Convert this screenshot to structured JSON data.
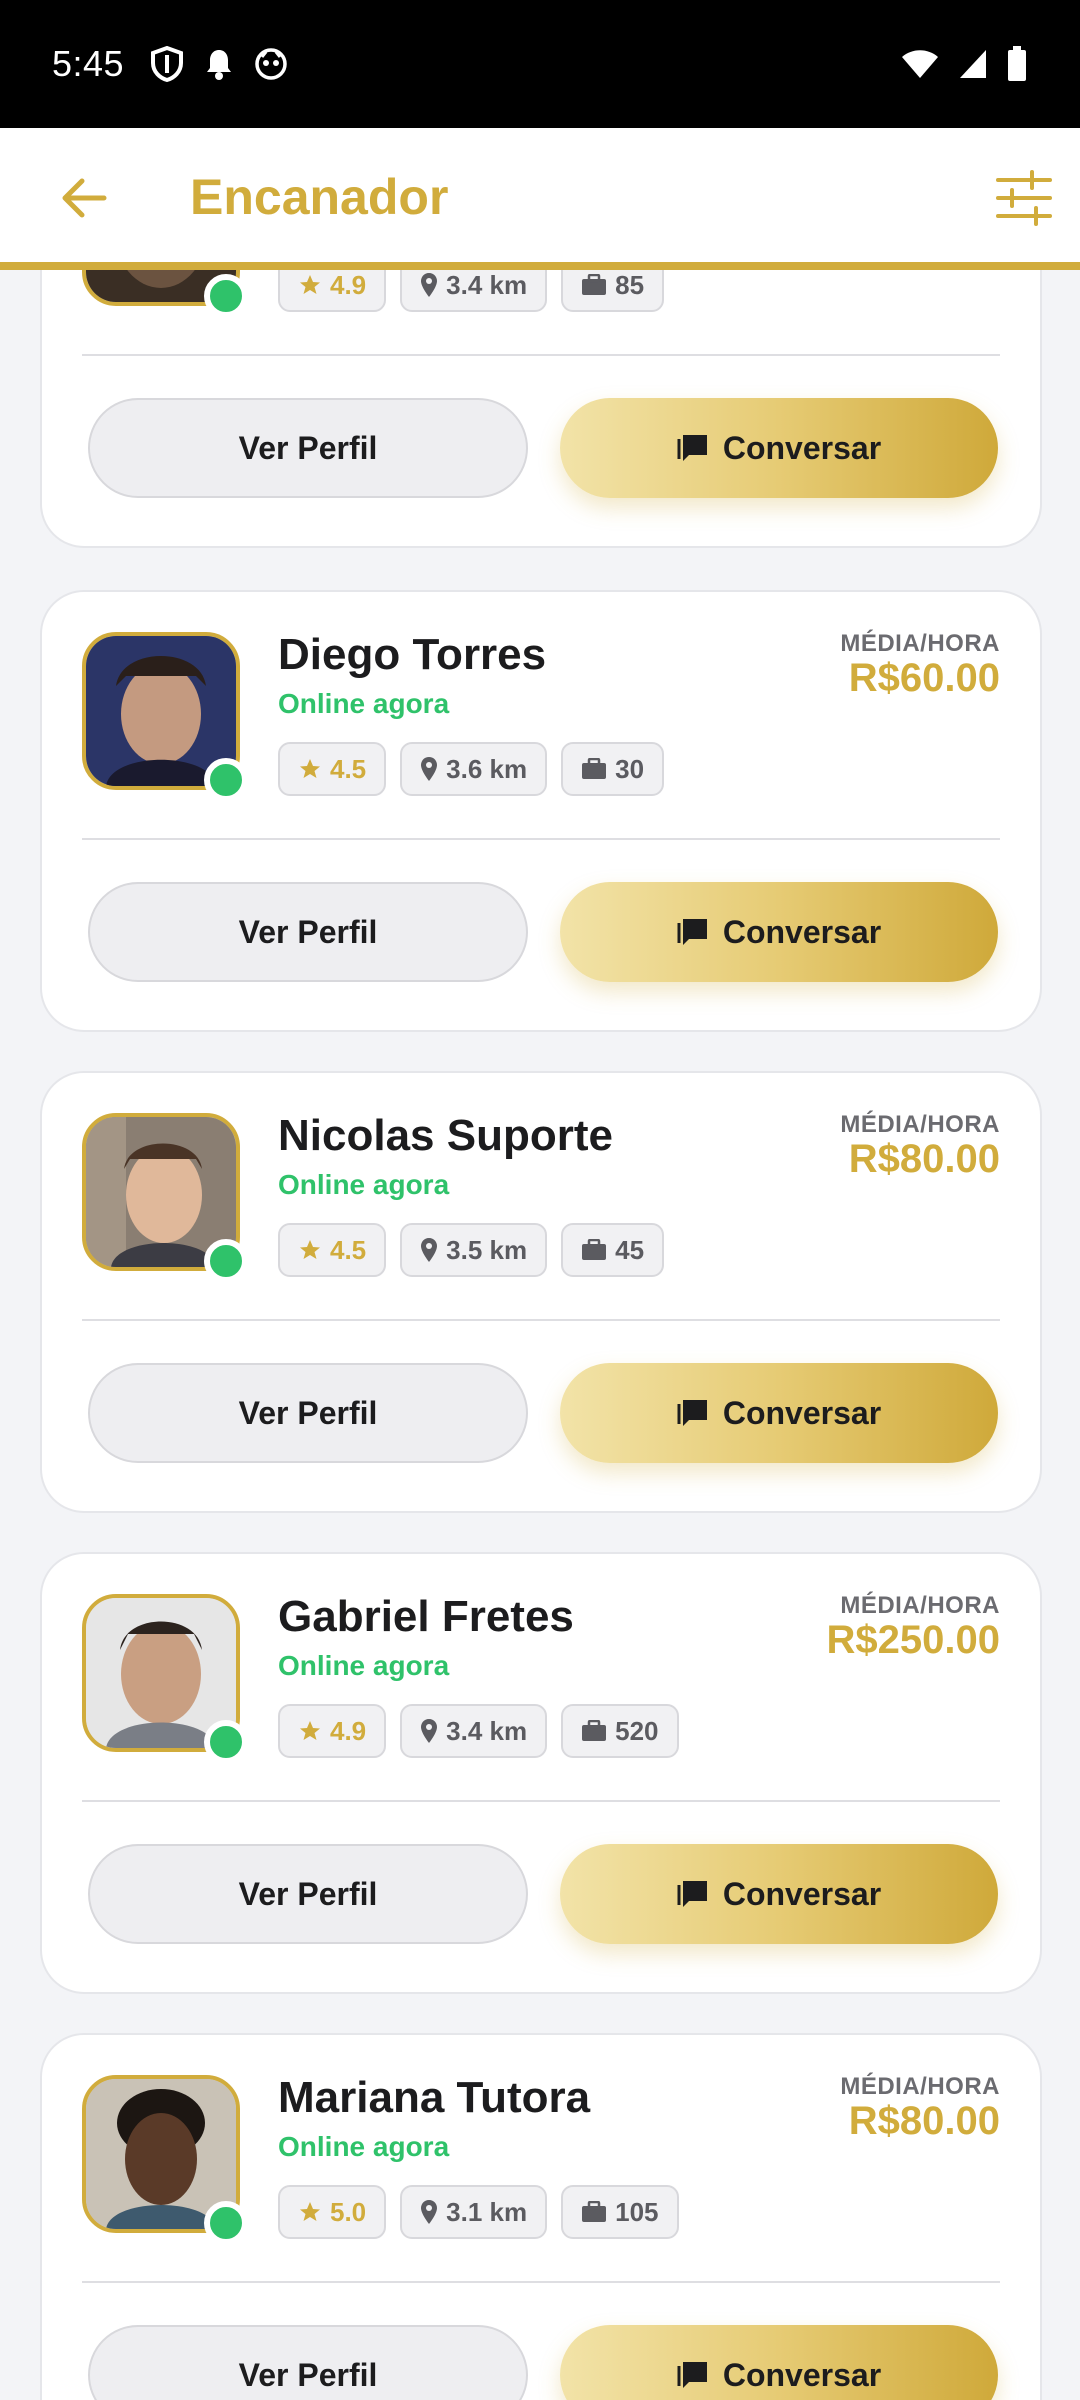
{
  "status_bar": {
    "time": "5:45"
  },
  "app_bar": {
    "title": "Encanador"
  },
  "labels": {
    "online": "Online agora",
    "rate_label": "MÉDIA/HORA",
    "view_profile": "Ver Perfil",
    "chat": "Conversar"
  },
  "colors": {
    "accent": "#d1ac3c",
    "online": "#2fc26a"
  },
  "providers": [
    {
      "name": "",
      "rating": "4.9",
      "distance": "3.4 km",
      "jobs": "85",
      "rate": ""
    },
    {
      "name": "Diego Torres",
      "rating": "4.5",
      "distance": "3.6 km",
      "jobs": "30",
      "rate": "R$60.00"
    },
    {
      "name": "Nicolas Suporte",
      "rating": "4.5",
      "distance": "3.5 km",
      "jobs": "45",
      "rate": "R$80.00"
    },
    {
      "name": "Gabriel Fretes",
      "rating": "4.9",
      "distance": "3.4 km",
      "jobs": "520",
      "rate": "R$250.00"
    },
    {
      "name": "Mariana Tutora",
      "rating": "5.0",
      "distance": "3.1 km",
      "jobs": "105",
      "rate": "R$80.00"
    }
  ]
}
